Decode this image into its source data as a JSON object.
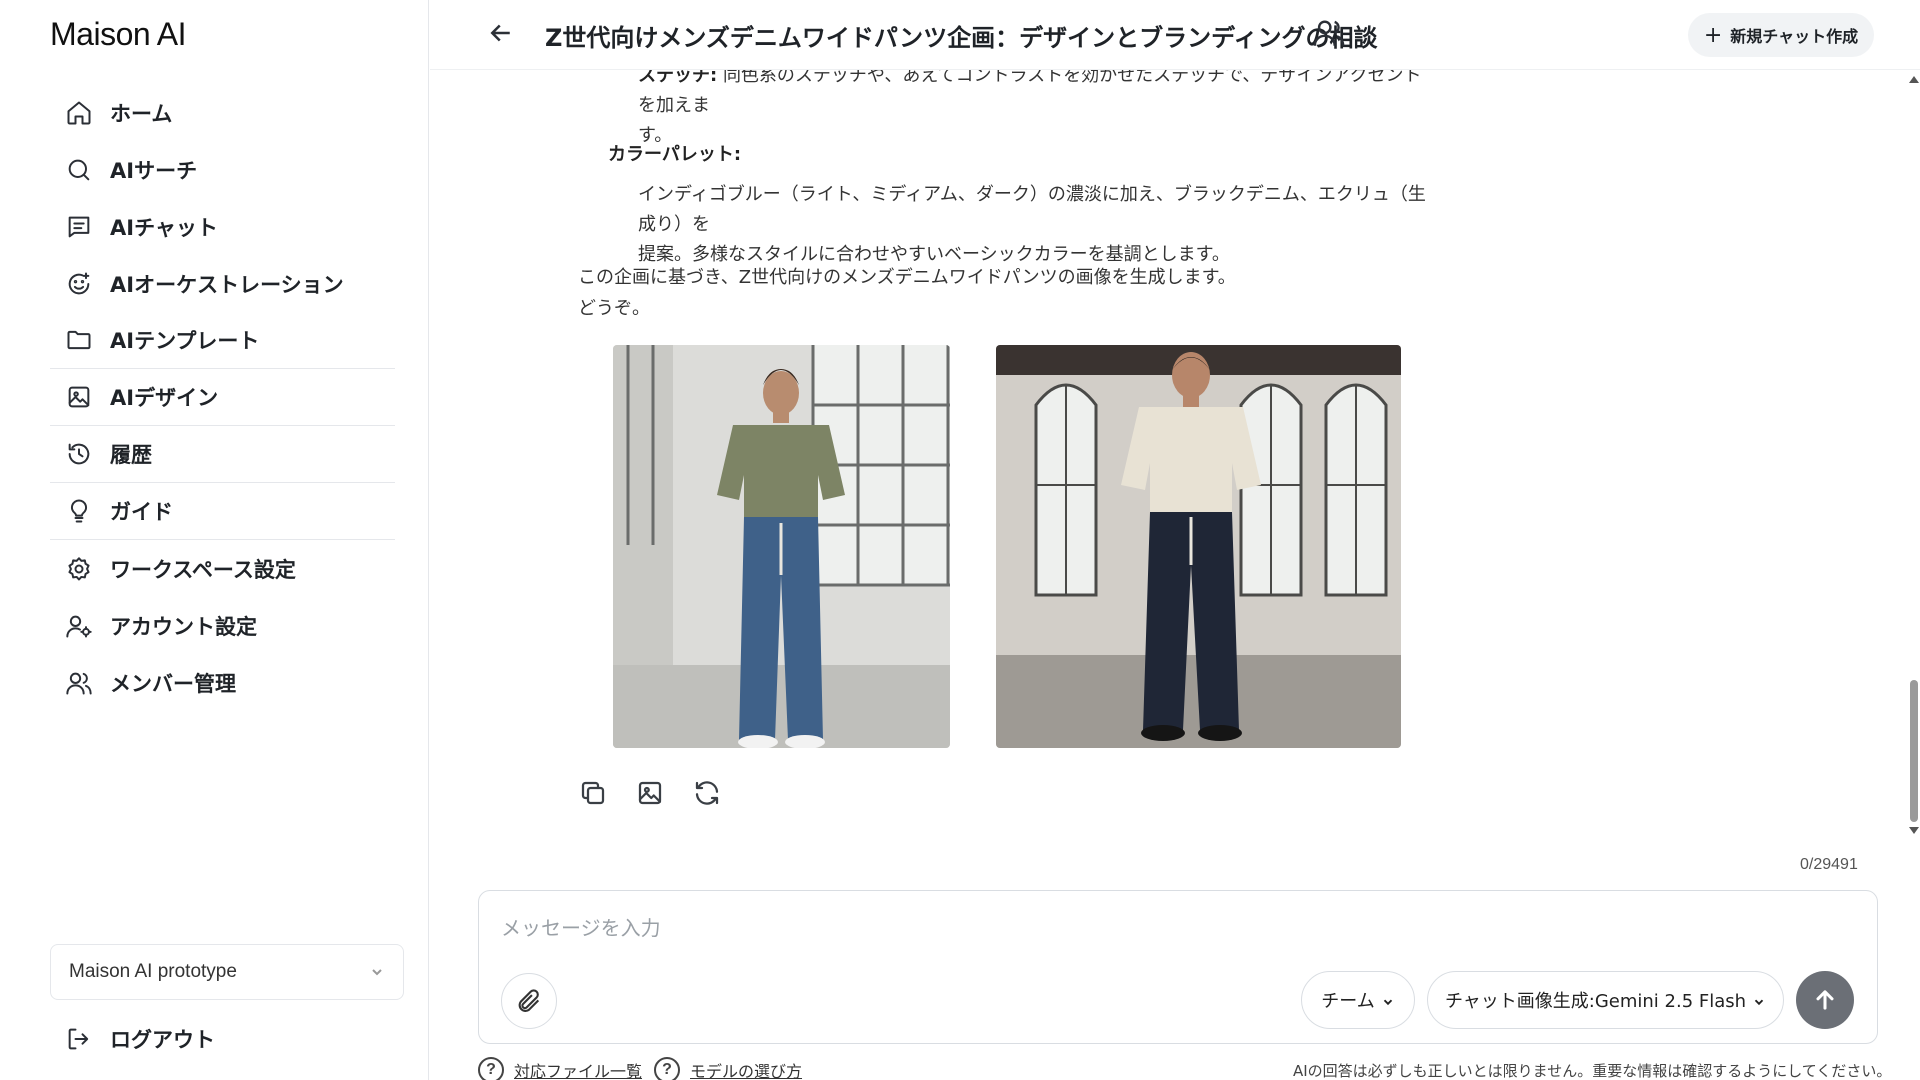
{
  "app": {
    "brand": "Maison AI"
  },
  "sidebar": {
    "items": [
      {
        "label": "ホーム",
        "icon": "home-icon"
      },
      {
        "label": "AIサーチ",
        "icon": "search-icon"
      },
      {
        "label": "AIチャット",
        "icon": "chat-icon"
      },
      {
        "label": "AIオーケストレーション",
        "icon": "orchestration-icon"
      },
      {
        "label": "AIテンプレート",
        "icon": "folder-icon"
      },
      {
        "label": "AIデザイン",
        "icon": "image-icon"
      },
      {
        "label": "履歴",
        "icon": "history-icon"
      },
      {
        "label": "ガイド",
        "icon": "lightbulb-icon"
      },
      {
        "label": "ワークスペース設定",
        "icon": "gear-icon"
      },
      {
        "label": "アカウント設定",
        "icon": "user-settings-icon"
      },
      {
        "label": "メンバー管理",
        "icon": "users-icon"
      }
    ],
    "workspace": "Maison AI prototype",
    "logout": "ログアウト"
  },
  "header": {
    "title": "Z世代向けメンズデニムワイドパンツ企画：デザインとブランディングの相談",
    "new_chat": "新規チャット作成"
  },
  "message": {
    "stitch_label": "ステッチ:",
    "stitch_text": "同色系のステッチや、あえてコントラストを効かせたステッチで、デザインアクセントを加えま",
    "stitch_text2": "す。",
    "palette_label": "カラーパレット:",
    "palette_text1": "インディゴブルー（ライト、ミディアム、ダーク）の濃淡に加え、ブラックデニム、エクリュ（生成り）を",
    "palette_text2": "提案。多様なスタイルに合わせやすいベーシックカラーを基調とします。",
    "closing1": "この企画に基づき、Z世代向けのメンズデニムワイドパンツの画像を生成します。",
    "closing2": "どうぞ。",
    "images": [
      {
        "alt": "generated-image-1",
        "shirt": "#7d8465",
        "pants": "#3f6189",
        "bg": "#d9d9d6"
      },
      {
        "alt": "generated-image-2",
        "shirt": "#e8e2d4",
        "pants": "#1f2636",
        "bg": "#cfcbc4"
      }
    ]
  },
  "composer": {
    "char_count": "0/29491",
    "placeholder": "メッセージを入力",
    "scope": "チーム",
    "model": "チャット画像生成:Gemini 2.5 Flash"
  },
  "footer": {
    "files_link": "対応ファイル一覧",
    "models_link": "モデルの選び方",
    "disclaimer": "AIの回答は必ずしも正しいとは限りません。重要な情報は確認するようにしてください。"
  }
}
